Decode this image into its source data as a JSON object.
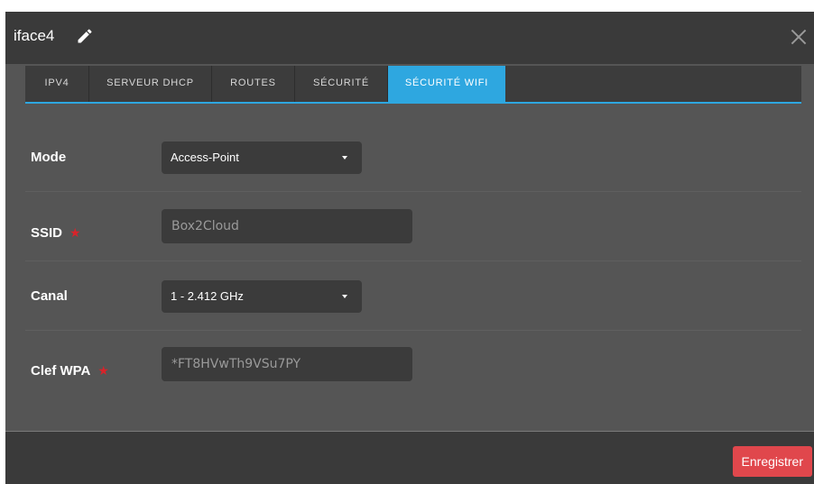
{
  "dialog": {
    "title": "iface4",
    "edit_icon": "pencil-icon",
    "close_icon": "close-icon"
  },
  "tabs": [
    {
      "label": "IPV4",
      "active": false
    },
    {
      "label": "SERVEUR DHCP",
      "active": false
    },
    {
      "label": "ROUTES",
      "active": false
    },
    {
      "label": "SÉCURITÉ",
      "active": false
    },
    {
      "label": "SÉCURITÉ WIFI",
      "active": true
    }
  ],
  "form": {
    "mode": {
      "label": "Mode",
      "value": "Access-Point"
    },
    "ssid": {
      "label": "SSID",
      "required_mark": "★",
      "value": "Box2Cloud"
    },
    "canal": {
      "label": "Canal",
      "value": "1 - 2.412 GHz"
    },
    "wpa": {
      "label": "Clef WPA",
      "required_mark": "★",
      "value": "*FT8HVwTh9VSu7PY"
    }
  },
  "footer": {
    "save_label": "Enregistrer"
  },
  "colors": {
    "accent": "#2ea7e0",
    "danger": "#e0474c",
    "required": "#d9232a"
  }
}
